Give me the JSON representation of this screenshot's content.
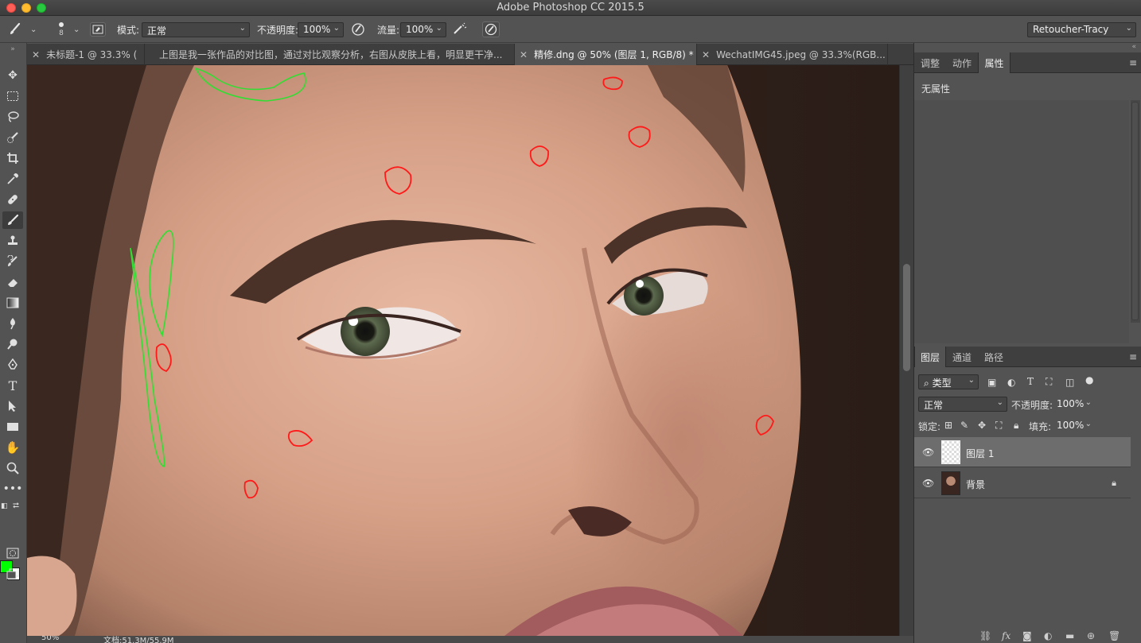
{
  "window": {
    "title": "Adobe Photoshop CC 2015.5"
  },
  "options_bar": {
    "brush_size": "8",
    "mode_label": "模式:",
    "mode_value": "正常",
    "opacity_label": "不透明度:",
    "opacity_value": "100%",
    "flow_label": "流量:",
    "flow_value": "100%",
    "workspace": "Retoucher-Tracy"
  },
  "tabs": [
    {
      "label": "未标题-1 @ 33.3% (",
      "active": false
    },
    {
      "label": "上图是我一张作品的对比图，通过对比观察分析，右图从皮肤上看，明显更干净...",
      "active": false
    },
    {
      "label": "精修.dng @ 50% (图层 1, RGB/8) *",
      "active": true
    },
    {
      "label": "WechatIMG45.jpeg @ 33.3%(RGB...",
      "active": false
    }
  ],
  "status": {
    "zoom": "50%",
    "doc": "文档:51.3M/55.9M"
  },
  "properties_panel": {
    "tabs": [
      "调整",
      "动作",
      "属性"
    ],
    "active_tab": "属性",
    "empty_label": "无属性"
  },
  "layers_panel": {
    "tabs": [
      "图层",
      "通道",
      "路径"
    ],
    "filter_label": "类型",
    "blend_mode": "正常",
    "opacity_label": "不透明度:",
    "opacity_value": "100%",
    "lock_label": "锁定:",
    "fill_label": "填充:",
    "fill_value": "100%",
    "layers": [
      {
        "name": "图层 1",
        "selected": true,
        "locked": false
      },
      {
        "name": "背景",
        "selected": false,
        "locked": true
      }
    ]
  },
  "colors": {
    "foreground": "#00ff00",
    "background": "#ffffff",
    "markup_red": "#ff1a1a",
    "markup_green": "#33dd33"
  }
}
